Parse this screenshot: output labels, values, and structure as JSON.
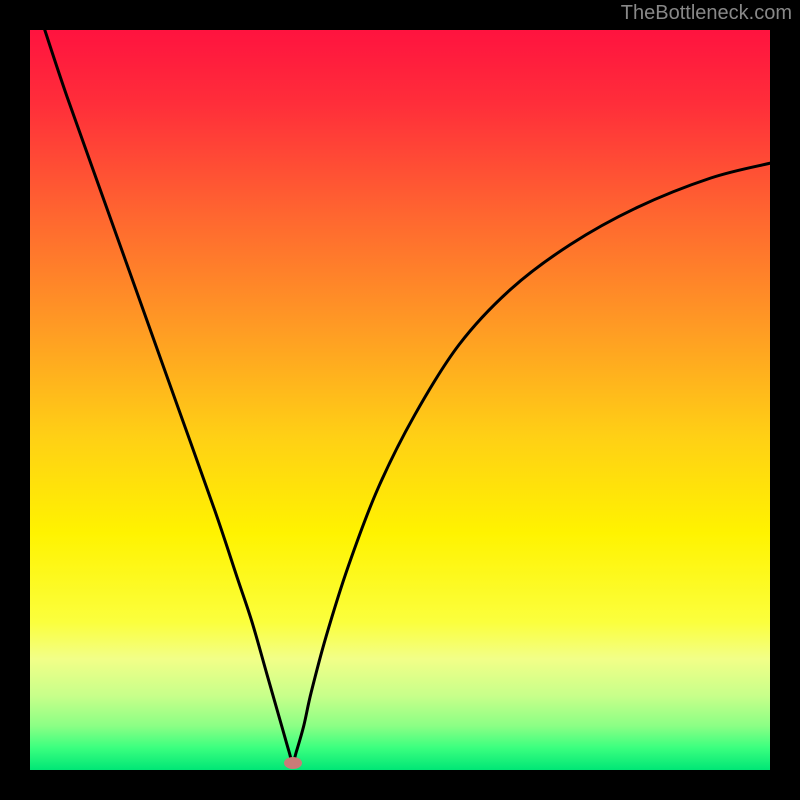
{
  "watermark": "TheBottleneck.com",
  "chart_data": {
    "type": "line",
    "title": "",
    "xlabel": "",
    "ylabel": "",
    "xlim": [
      0,
      100
    ],
    "ylim": [
      0,
      100
    ],
    "grid": false,
    "legend": false,
    "background_gradient_stops": [
      {
        "offset": 0,
        "color": "#ff133f"
      },
      {
        "offset": 10,
        "color": "#ff2e3a"
      },
      {
        "offset": 25,
        "color": "#ff6630"
      },
      {
        "offset": 40,
        "color": "#ff9a24"
      },
      {
        "offset": 55,
        "color": "#ffd015"
      },
      {
        "offset": 68,
        "color": "#fff300"
      },
      {
        "offset": 80,
        "color": "#fbff3d"
      },
      {
        "offset": 85,
        "color": "#f2ff88"
      },
      {
        "offset": 90,
        "color": "#c7ff8a"
      },
      {
        "offset": 94,
        "color": "#8cff85"
      },
      {
        "offset": 97,
        "color": "#3bff7f"
      },
      {
        "offset": 100,
        "color": "#00e676"
      }
    ],
    "series": [
      {
        "name": "bottleneck-curve",
        "stroke": "#000000",
        "stroke_width": 3,
        "x": [
          2,
          5,
          10,
          15,
          20,
          25,
          28,
          30,
          32,
          34,
          35,
          35.5,
          36,
          37,
          38,
          40,
          43,
          47,
          52,
          58,
          65,
          73,
          82,
          92,
          100
        ],
        "y": [
          100,
          91,
          77,
          63,
          49,
          35,
          26,
          20,
          13,
          6,
          2.5,
          1,
          2.5,
          6,
          10.5,
          18,
          27.5,
          38,
          48,
          57.5,
          65,
          71,
          76,
          80,
          82
        ]
      }
    ],
    "marker": {
      "name": "minimum",
      "x": 35.5,
      "y": 1,
      "color": "#c97c78"
    }
  }
}
